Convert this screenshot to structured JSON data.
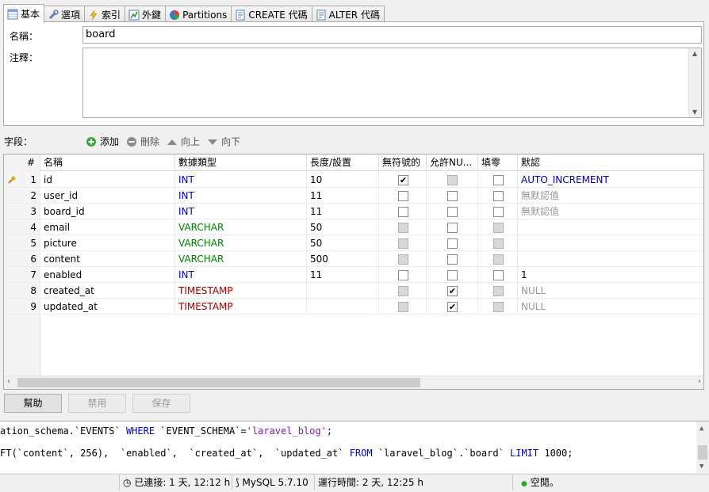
{
  "tabs": [
    {
      "label": "基本",
      "icon": "table-icon",
      "active": true
    },
    {
      "label": "選項",
      "icon": "wrench-icon"
    },
    {
      "label": "索引",
      "icon": "lightning-icon"
    },
    {
      "label": "外鍵",
      "icon": "foreign-key-icon"
    },
    {
      "label": "Partitions",
      "icon": "pie-chart-icon"
    },
    {
      "label": "CREATE 代碼",
      "icon": "sql-document-icon"
    },
    {
      "label": "ALTER 代碼",
      "icon": "sql-document-icon"
    }
  ],
  "form": {
    "name_label": "名稱：",
    "name_value": "board",
    "comment_label": "注釋：",
    "comment_value": ""
  },
  "fields_toolbar": {
    "label": "字段：",
    "add": "添加",
    "delete": "刪除",
    "up": "向上",
    "down": "向下"
  },
  "grid": {
    "headers": [
      "#",
      "名稱",
      "數據類型",
      "長度/設置",
      "無符號的",
      "允許NU...",
      "填零",
      "默認"
    ],
    "rows": [
      {
        "num": "1",
        "name": "id",
        "type": "INT",
        "len": "10",
        "unsigned": true,
        "unsigned_enabled": true,
        "allow_null": false,
        "allow_null_enabled": false,
        "zerofill": false,
        "zerofill_enabled": true,
        "default": "AUTO_INCREMENT",
        "key": true
      },
      {
        "num": "2",
        "name": "user_id",
        "type": "INT",
        "len": "11",
        "unsigned": false,
        "unsigned_enabled": true,
        "allow_null": false,
        "allow_null_enabled": true,
        "zerofill": false,
        "zerofill_enabled": true,
        "default": "無默認值"
      },
      {
        "num": "3",
        "name": "board_id",
        "type": "INT",
        "len": "11",
        "unsigned": false,
        "unsigned_enabled": true,
        "allow_null": false,
        "allow_null_enabled": true,
        "zerofill": false,
        "zerofill_enabled": true,
        "default": "無默認值"
      },
      {
        "num": "4",
        "name": "email",
        "type": "VARCHAR",
        "len": "50",
        "unsigned": false,
        "unsigned_enabled": false,
        "allow_null": false,
        "allow_null_enabled": true,
        "zerofill": false,
        "zerofill_enabled": false,
        "default": ""
      },
      {
        "num": "5",
        "name": "picture",
        "type": "VARCHAR",
        "len": "50",
        "unsigned": false,
        "unsigned_enabled": false,
        "allow_null": false,
        "allow_null_enabled": true,
        "zerofill": false,
        "zerofill_enabled": false,
        "default": ""
      },
      {
        "num": "6",
        "name": "content",
        "type": "VARCHAR",
        "len": "500",
        "unsigned": false,
        "unsigned_enabled": false,
        "allow_null": false,
        "allow_null_enabled": true,
        "zerofill": false,
        "zerofill_enabled": false,
        "default": ""
      },
      {
        "num": "7",
        "name": "enabled",
        "type": "INT",
        "len": "11",
        "unsigned": false,
        "unsigned_enabled": true,
        "allow_null": false,
        "allow_null_enabled": true,
        "zerofill": false,
        "zerofill_enabled": true,
        "default": "1"
      },
      {
        "num": "8",
        "name": "created_at",
        "type": "TIMESTAMP",
        "len": "",
        "unsigned": false,
        "unsigned_enabled": false,
        "allow_null": true,
        "allow_null_enabled": true,
        "zerofill": false,
        "zerofill_enabled": false,
        "default": "NULL"
      },
      {
        "num": "9",
        "name": "updated_at",
        "type": "TIMESTAMP",
        "len": "",
        "unsigned": false,
        "unsigned_enabled": false,
        "allow_null": true,
        "allow_null_enabled": true,
        "zerofill": false,
        "zerofill_enabled": false,
        "default": "NULL"
      }
    ]
  },
  "type_colors": {
    "INT": "#0000cc",
    "VARCHAR": "#008000",
    "TIMESTAMP": "#a00000"
  },
  "buttons": {
    "help": "幫助",
    "discard": "禁用",
    "save": "保存"
  },
  "sql_log": [
    [
      {
        "t": "ation_schema.`EVENTS` "
      },
      {
        "t": "WHERE",
        "c": "kw"
      },
      {
        "t": " `EVENT_SCHEMA`="
      },
      {
        "t": "'laravel_blog'",
        "c": "str"
      },
      {
        "t": ";"
      }
    ],
    [
      {
        "t": "FT(`content`, 256),  `enabled`,  `created_at`,  `updated_at` "
      },
      {
        "t": "FROM",
        "c": "kw"
      },
      {
        "t": " `laravel_blog`.`board` "
      },
      {
        "t": "LIMIT",
        "c": "kw"
      },
      {
        "t": " 1000;"
      }
    ]
  ],
  "status": {
    "connected": "已連接: 1 天, 12:12 h",
    "server": "MySQL 5.7.10",
    "uptime": "運行時間: 2 天, 12:25 h",
    "idle": "空閒。"
  }
}
